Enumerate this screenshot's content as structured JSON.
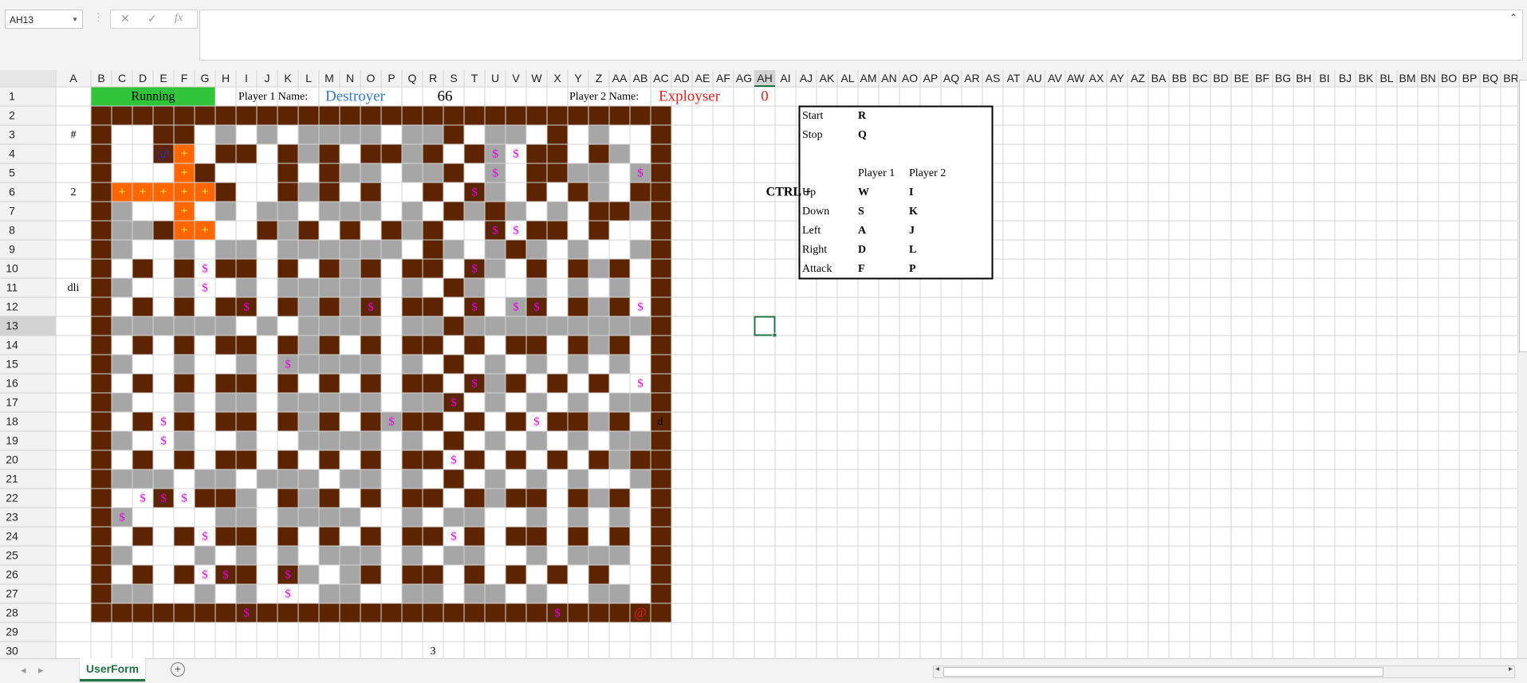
{
  "formula_bar": {
    "name_box": "AH13",
    "cancel_icon": "✕",
    "enter_icon": "✓",
    "fx_label": "fx",
    "formula_value": ""
  },
  "columns": [
    "A",
    "B",
    "C",
    "D",
    "E",
    "F",
    "G",
    "H",
    "I",
    "J",
    "K",
    "L",
    "M",
    "N",
    "O",
    "P",
    "Q",
    "R",
    "S",
    "T",
    "U",
    "V",
    "W",
    "X",
    "Y",
    "Z",
    "AA",
    "AB",
    "AC",
    "AD",
    "AE",
    "AF",
    "AG",
    "AH",
    "AI",
    "AJ",
    "AK",
    "AL",
    "AM",
    "AN",
    "AO",
    "AP",
    "AQ",
    "AR",
    "AS",
    "AT",
    "AU",
    "AV",
    "AW",
    "AX",
    "AY",
    "AZ",
    "BA",
    "BB",
    "BC",
    "BD",
    "BE",
    "BF",
    "BG",
    "BH",
    "BI",
    "BJ",
    "BK",
    "BL",
    "BM",
    "BN",
    "BO",
    "BP",
    "BQ",
    "BR",
    "BS"
  ],
  "rows": [
    "1",
    "2",
    "3",
    "4",
    "5",
    "6",
    "7",
    "8",
    "9",
    "10",
    "11",
    "12",
    "13",
    "14",
    "15",
    "16",
    "17",
    "18",
    "19",
    "20",
    "21",
    "22",
    "23",
    "24",
    "25",
    "26",
    "27",
    "28",
    "29",
    "30",
    "31"
  ],
  "selected_cell": "AH13",
  "colors": {
    "wall": "#5c2500",
    "floor_gray": "#a6a6a6",
    "floor_white": "#ffffff",
    "player_trail": "#ff6600",
    "running_green": "#2fc43a",
    "player1_blue": "#2f7bd6",
    "player2_red": "#e8201a",
    "coin_magenta": "#e600e6",
    "selection_green": "#217346"
  },
  "header_row": {
    "status": "Running",
    "player1_label": "Player 1 Name:",
    "player1_name": "Destroyer",
    "player1_score": "66",
    "player2_label": "Player 2 Name:",
    "player2_name": "Exployser",
    "player2_score": "0"
  },
  "side_labels": {
    "hash": "#",
    "two": "2",
    "dli": "dli",
    "d": "d",
    "three": "3"
  },
  "controls": {
    "ctrl_label": "CTRL +",
    "rows": [
      {
        "action": "Start",
        "p1": "R",
        "p2": ""
      },
      {
        "action": "Stop",
        "p1": "Q",
        "p2": ""
      },
      {
        "action": "",
        "p1": "Player 1",
        "p2": "Player 2"
      },
      {
        "action": "Up",
        "p1": "W",
        "p2": "I"
      },
      {
        "action": "Down",
        "p1": "S",
        "p2": "K"
      },
      {
        "action": "Left",
        "p1": "A",
        "p2": "J"
      },
      {
        "action": "Right",
        "p1": "D",
        "p2": "L"
      },
      {
        "action": "Attack",
        "p1": "F",
        "p2": "P"
      }
    ]
  },
  "maze": {
    "legend": "W=wall, G=gray floor, .=white floor",
    "rows": [
      "WWWWWWWWWWWWWWWWWWWWWWWWWWWW",
      "W..WW.G.G.GGGG.GGW.GG.W.G..W",
      "W..WW.WW.WGW.WWGW.WG.WW.WG.W",
      "W....W...W.WGG.GGW.G.WWGG.GW",
      "W.G.W.W..WGW.W..W.WG.W.WG.WW",
      "WG..W.G.GG.GGG.G.WGWG.G.WWGW",
      "WGGW.W..WGW.W.WGW..W.WW.W..W",
      "WG..G.GG.GGGGGG.WG.GWG.G..GW",
      "W.W.W.WW.W.WGW.WW.WG.W.WGW.W",
      "WG..G..G.GGGGG.G.WG..G.G.G.W",
      "W.W.W.WW.WGWGW.WW.W.GW.WGW.W",
      "WGGGGGG.G.GGGG.GGWGGGGGGGGGW",
      "W.W.W.WW.WGW.W.WW.W.WW.WGW.W",
      "WG..G..G.GGGGG.G.W.G.G.G.G.W",
      "W.W.W.WW.W.W.W.WW.WGW.W.W..W",
      "WG..G.GG.GGGGG.GGW.G.G.G.GGW",
      "W.W.W.WW.WGW.WGWW.W.W.WWGW.W",
      "WG..G..G..GGGG.G.W.G.G.G.GGW",
      "W.W.W.WW.W.W.W.WW.W.W.W.WGWW",
      "WGGG.GG.GGG.GG.G.W.G.G.G..GW",
      "W..W.WWG.WGW.W.WW.WGWW.WGW.W",
      "WG....GG.GGGG..G.GG..G.G.G.W",
      "W.W.W.WW.W.W.W.WW.W.WW.W.W.W",
      "WG...G.G.G.GGG.G.GG..G.GGG.W",
      "W.W.W.WW.WG.GW.WW.W.W.W.W..W",
      "WGG..G.G...GG..GG.GG.G..GG.W",
      "WWWWWWWWWWWWWWWWWWWWWWWWWWWW"
    ],
    "trail": [
      [
        1,
        3
      ],
      [
        2,
        3
      ],
      [
        3,
        0
      ],
      [
        3,
        1
      ],
      [
        3,
        2
      ],
      [
        3,
        3
      ],
      [
        3,
        4
      ],
      [
        4,
        3
      ],
      [
        5,
        3
      ],
      [
        5,
        4
      ]
    ],
    "players": [
      {
        "cell": [
          1,
          2
        ],
        "glyph": "@",
        "color": "#2f2fb8"
      },
      {
        "cell": [
          25,
          25
        ],
        "glyph": "@",
        "color": "#e8201a"
      }
    ],
    "coin_glyph": "$",
    "coins": [
      [
        1,
        18
      ],
      [
        1,
        19
      ],
      [
        2,
        18
      ],
      [
        2,
        25
      ],
      [
        3,
        17
      ],
      [
        5,
        18
      ],
      [
        5,
        19
      ],
      [
        7,
        4
      ],
      [
        7,
        17
      ],
      [
        8,
        4
      ],
      [
        9,
        6
      ],
      [
        9,
        12
      ],
      [
        9,
        17
      ],
      [
        9,
        19
      ],
      [
        9,
        20
      ],
      [
        9,
        25
      ],
      [
        12,
        8
      ],
      [
        13,
        17
      ],
      [
        13,
        25
      ],
      [
        14,
        16
      ],
      [
        15,
        2
      ],
      [
        15,
        13
      ],
      [
        15,
        20
      ],
      [
        16,
        2
      ],
      [
        17,
        16
      ],
      [
        19,
        1
      ],
      [
        19,
        2
      ],
      [
        19,
        3
      ],
      [
        20,
        0
      ],
      [
        21,
        4
      ],
      [
        21,
        16
      ],
      [
        23,
        4
      ],
      [
        23,
        5
      ],
      [
        23,
        8
      ],
      [
        24,
        8
      ],
      [
        25,
        6
      ],
      [
        25,
        21
      ]
    ]
  }
}
